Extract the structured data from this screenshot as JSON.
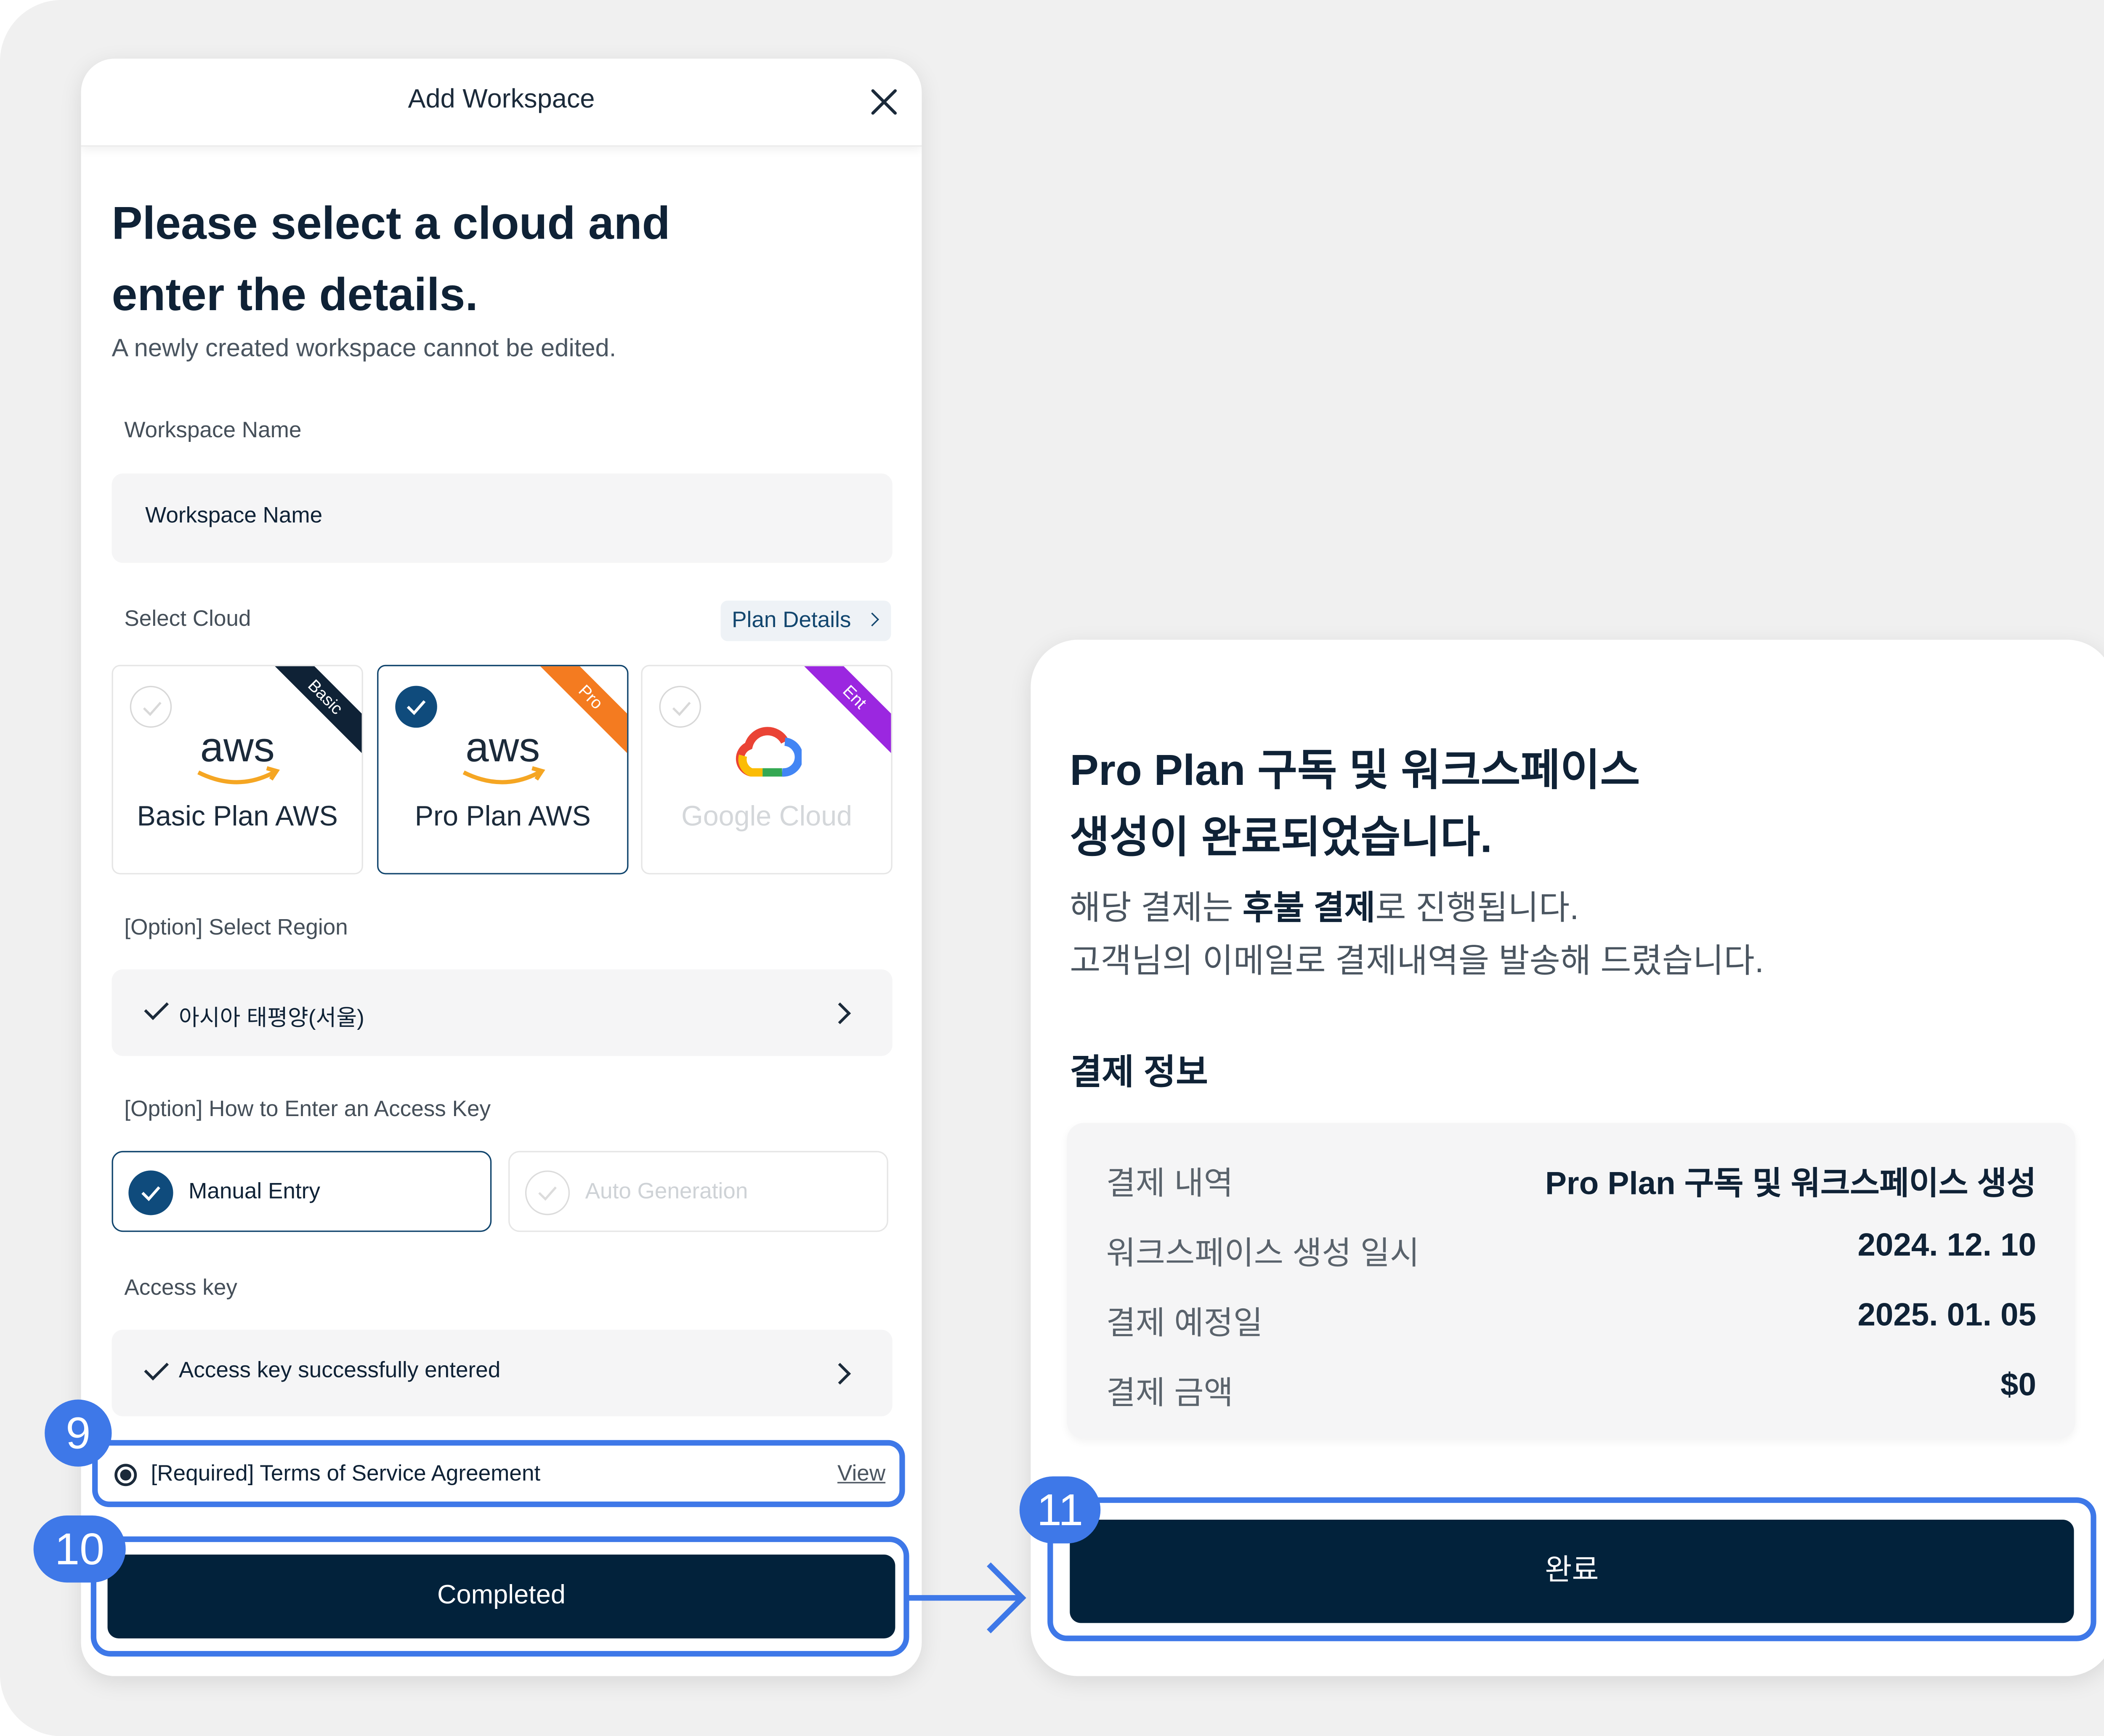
{
  "modal": {
    "title": "Add Workspace",
    "heading": "Please select a cloud and enter the details.",
    "subtext": "A newly created workspace cannot be edited.",
    "workspace_name_label": "Workspace Name",
    "workspace_name_value": "Workspace Name",
    "select_cloud_label": "Select Cloud",
    "plan_details_link": "Plan Details",
    "clouds": [
      {
        "name": "Basic Plan AWS",
        "badge": "Basic",
        "badge_color": "#0f2236",
        "selected": false
      },
      {
        "name": "Pro Plan AWS",
        "badge": "Pro",
        "badge_color": "#f47b20",
        "selected": true
      },
      {
        "name": "Google Cloud",
        "badge": "Ent",
        "badge_color": "#9b27e0",
        "selected": false,
        "disabled": true
      }
    ],
    "region_label": "[Option] Select Region",
    "region_value": "아시아 태평양(서울)",
    "access_method_label": "[Option] How to Enter an Access Key",
    "access_methods": [
      "Manual Entry",
      "Auto Generation"
    ],
    "access_key_label": "Access key",
    "access_key_value": "Access key successfully entered",
    "terms_text": "[Required] Terms of Service Agreement",
    "terms_link": "View",
    "complete_button": "Completed"
  },
  "steps": [
    "9",
    "10",
    "11"
  ],
  "result": {
    "title_line1": "Pro Plan 구독 및 워크스페이스",
    "title_line2": "생성이 완료되었습니다.",
    "desc_pre": "해당 결제는 ",
    "desc_bold": "후불 결제",
    "desc_post": "로 진행됩니다.",
    "desc_line2": "고객님의 이메일로 결제내역을 발송해 드렸습니다.",
    "section_title": "결제 정보",
    "rows": [
      {
        "label": "결제 내역",
        "value": "Pro Plan 구독 및 워크스페이스 생성"
      },
      {
        "label": "워크스페이스 생성 일시",
        "value": "2024. 12. 10"
      },
      {
        "label": "결제 예정일",
        "value": "2025. 01. 05"
      },
      {
        "label": "결제 금액",
        "value": "$0"
      }
    ],
    "done_button": "완료"
  },
  "colors": {
    "primary": "#02223b",
    "highlight": "#3e78e8",
    "accent": "#0f4b7c"
  }
}
